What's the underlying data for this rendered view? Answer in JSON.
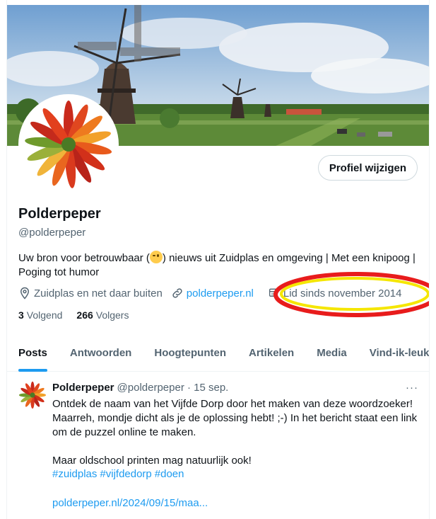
{
  "profile": {
    "name": "Polderpeper",
    "handle": "@polderpeper",
    "bio_before": "Uw bron voor betrouwbaar (",
    "bio_after": ") nieuws uit Zuidplas en omgeving | Met een knipoog | Poging tot humor",
    "location": "Zuidplas en net daar buiten",
    "website": "polderpeper.nl",
    "joined": "Lid sinds november 2014",
    "following_count": "3",
    "following_label": "Volgend",
    "followers_count": "266",
    "followers_label": "Volgers",
    "edit_button": "Profiel wijzigen"
  },
  "tabs": [
    {
      "label": "Posts",
      "active": true
    },
    {
      "label": "Antwoorden",
      "active": false
    },
    {
      "label": "Hoogtepunten",
      "active": false
    },
    {
      "label": "Artikelen",
      "active": false
    },
    {
      "label": "Media",
      "active": false
    },
    {
      "label": "Vind-ik-leuks",
      "active": false
    }
  ],
  "tweet": {
    "author": "Polderpeper",
    "handle_date": "@polderpeper · 15 sep.",
    "body": "Ontdek de naam van het Vijfde Dorp door het maken van deze woordzoeker! Maarreh, mondje dicht als je de oplossing hebt! ;-) In het bericht staat een link om de puzzel online te maken.\n\nMaar oldschool printen mag natuurlijk ook!",
    "hashtags": [
      "#zuidplas",
      "#vijfdedorp",
      "#doen"
    ],
    "link": "polderpeper.nl/2024/09/15/maa...",
    "more": "···"
  },
  "icons": {
    "location": "location-pin-icon",
    "link": "link-icon",
    "calendar": "calendar-icon",
    "wink": "winking-face-emoji"
  },
  "colors": {
    "accent": "#1d9bf0",
    "highlight_outer": "#e81c1c",
    "highlight_inner": "#f5e600"
  }
}
